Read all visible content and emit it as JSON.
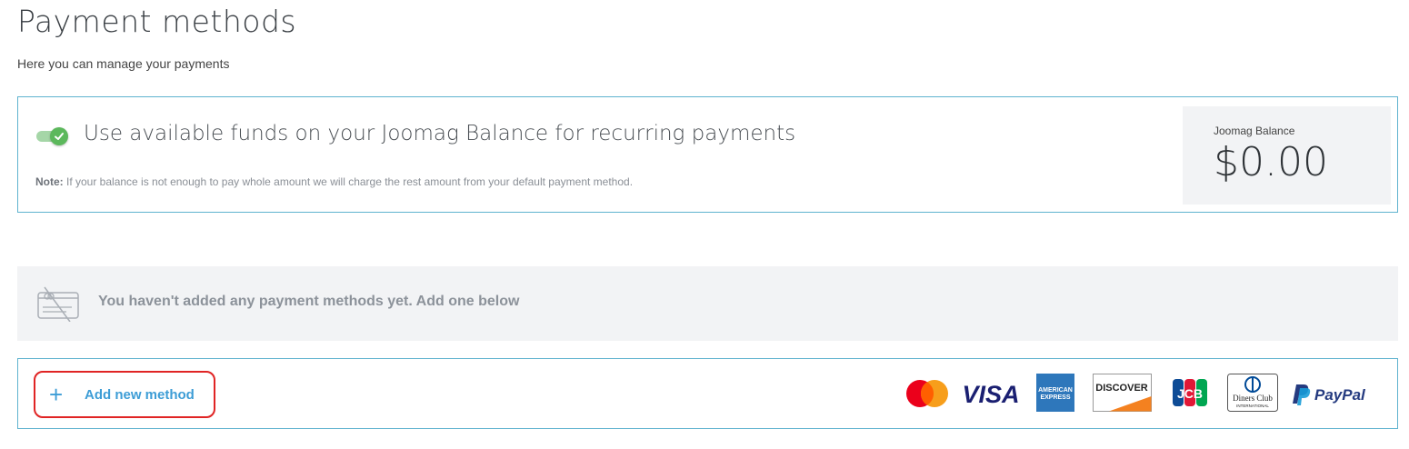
{
  "page": {
    "title": "Payment methods",
    "subtitle": "Here you can manage your payments"
  },
  "balance_card": {
    "toggle_on": true,
    "toggle_label": "Use available funds on your Joomag Balance for recurring payments",
    "note_label": "Note:",
    "note_text": " If your balance is not enough to pay whole amount we will charge the rest amount from your default payment method.",
    "balance_label": "Joomag Balance",
    "balance_amount": "$0.00"
  },
  "empty_state": {
    "text": "You haven't added any payment methods yet. Add one below"
  },
  "methods": {
    "add_label": "Add new method",
    "add_icon": "+",
    "logos": [
      {
        "name": "mastercard-logo"
      },
      {
        "name": "visa-logo",
        "text": "VISA"
      },
      {
        "name": "amex-logo",
        "text": "AMERICAN EXPRESS"
      },
      {
        "name": "discover-logo",
        "text": "DISCOVER"
      },
      {
        "name": "jcb-logo",
        "text": "JCB"
      },
      {
        "name": "diners-club-logo",
        "text": "Diners Club",
        "text2": "INTERNATIONAL"
      },
      {
        "name": "paypal-logo",
        "text": "PayPal"
      }
    ]
  },
  "colors": {
    "accent": "#3d9dd6",
    "card_border": "#5fb3cf",
    "toggle_on": "#5cb85c",
    "highlight": "#e02424"
  }
}
